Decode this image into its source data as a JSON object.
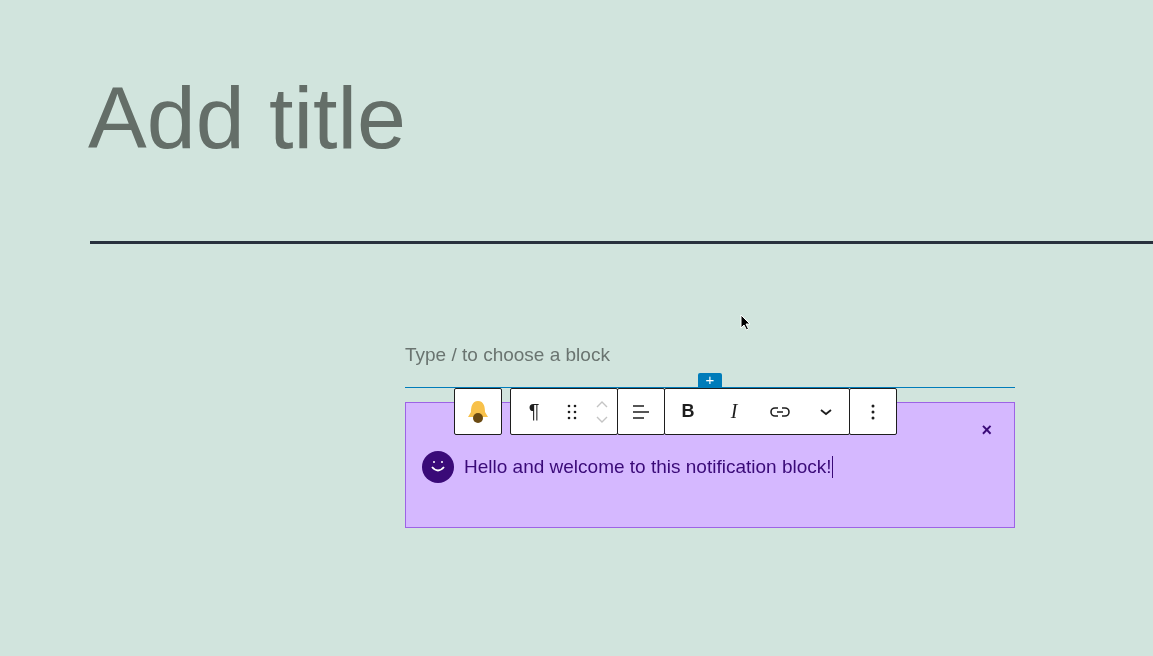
{
  "title": {
    "placeholder": "Add title"
  },
  "appender": {
    "placeholder": "Type / to choose a block",
    "insert_label": "+"
  },
  "toolbar": {
    "groups": [
      [
        {
          "kind": "bell"
        }
      ],
      [
        {
          "kind": "text",
          "label": "¶"
        },
        {
          "kind": "drag"
        },
        {
          "kind": "mover",
          "disabled": true
        }
      ],
      [
        {
          "kind": "align"
        }
      ],
      [
        {
          "kind": "bold",
          "label": "B"
        },
        {
          "kind": "italic",
          "label": "I"
        },
        {
          "kind": "link"
        },
        {
          "kind": "chevron"
        }
      ],
      [
        {
          "kind": "more"
        }
      ]
    ]
  },
  "notification": {
    "message": "Hello and welcome to this notification block!",
    "close_label": "×"
  }
}
